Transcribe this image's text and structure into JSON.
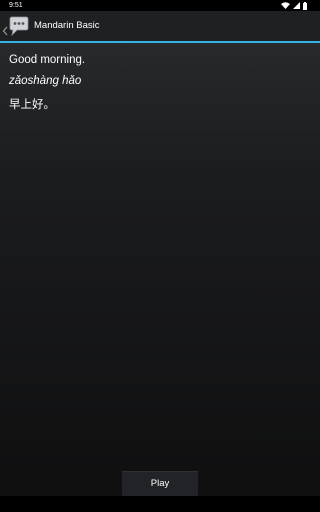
{
  "status_bar": {
    "time": "9:51",
    "icons": [
      "wifi-icon",
      "signal-icon",
      "battery-icon"
    ]
  },
  "action_bar": {
    "title": "Mandarin Basic",
    "accent_color": "#33b5e5",
    "icons": [
      "up-chevron-icon",
      "speech-bubble-icon"
    ]
  },
  "phrase": {
    "english": "Good morning.",
    "pinyin": "zǎoshàng hǎo",
    "hanzi": "早上好。"
  },
  "controls": {
    "play_label": "Play"
  }
}
